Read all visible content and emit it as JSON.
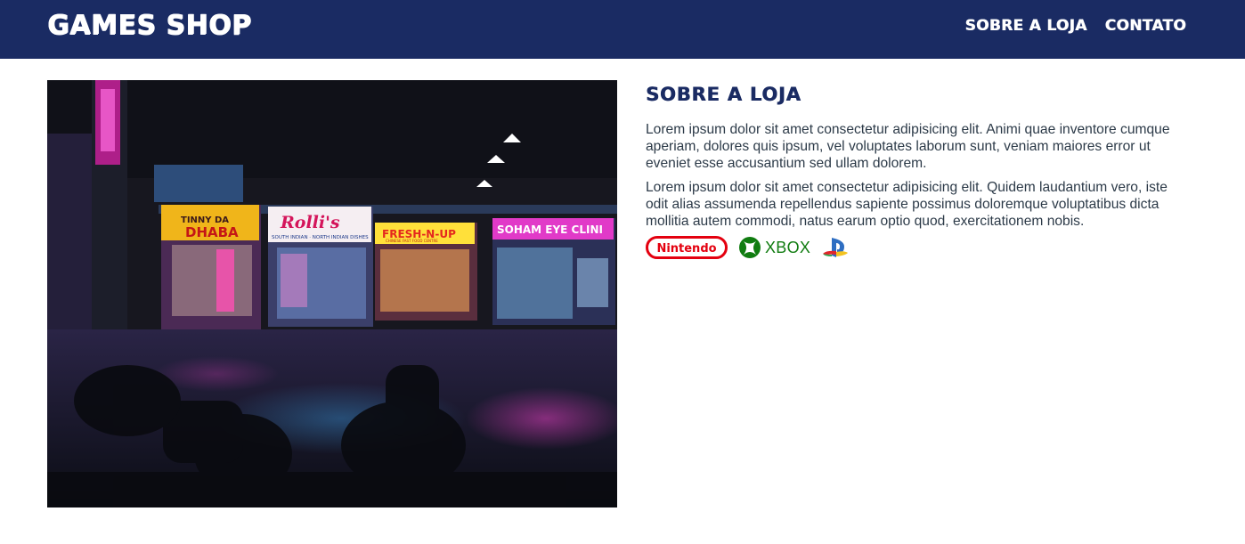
{
  "header": {
    "brand": "GAMES SHOP",
    "nav": [
      "SOBRE A LOJA",
      "CONTATO"
    ]
  },
  "about": {
    "title": "SOBRE A LOJA",
    "paragraphs": [
      "Lorem ipsum dolor sit amet consectetur adipisicing elit. Animi quae inventore cumque aperiam, dolores quis ipsum, vel voluptates laborum sunt, veniam maiores error ut eveniet esse accusantium sed ullam dolorem.",
      "Lorem ipsum dolor sit amet consectetur adipisicing elit. Quidem laudantium vero, iste odit alias assumenda repellendus sapiente possimus doloremque voluptatibus dicta mollitia autem commodi, natus earum optio quod, exercitationem nobis."
    ]
  },
  "logos": {
    "nintendo": "Nintendo",
    "xbox": "XBOX",
    "playstation": "playstation-icon"
  },
  "hero_signs": {
    "dhaba_top": "TINNY DA",
    "dhaba": "DHABA",
    "rollis": "Rolli's",
    "rollis_sub": "SOUTH INDIAN · NORTH INDIAN DISHES",
    "fresh": "FRESH-N-UP",
    "fresh_sub": "CHINESE FAST FOOD CENTRE",
    "soham": "SOHAM EYE CLINI"
  },
  "colors": {
    "header_bg": "#1a2b63",
    "title": "#1a2b63",
    "nintendo_red": "#e4000f",
    "xbox_green": "#107c10"
  }
}
